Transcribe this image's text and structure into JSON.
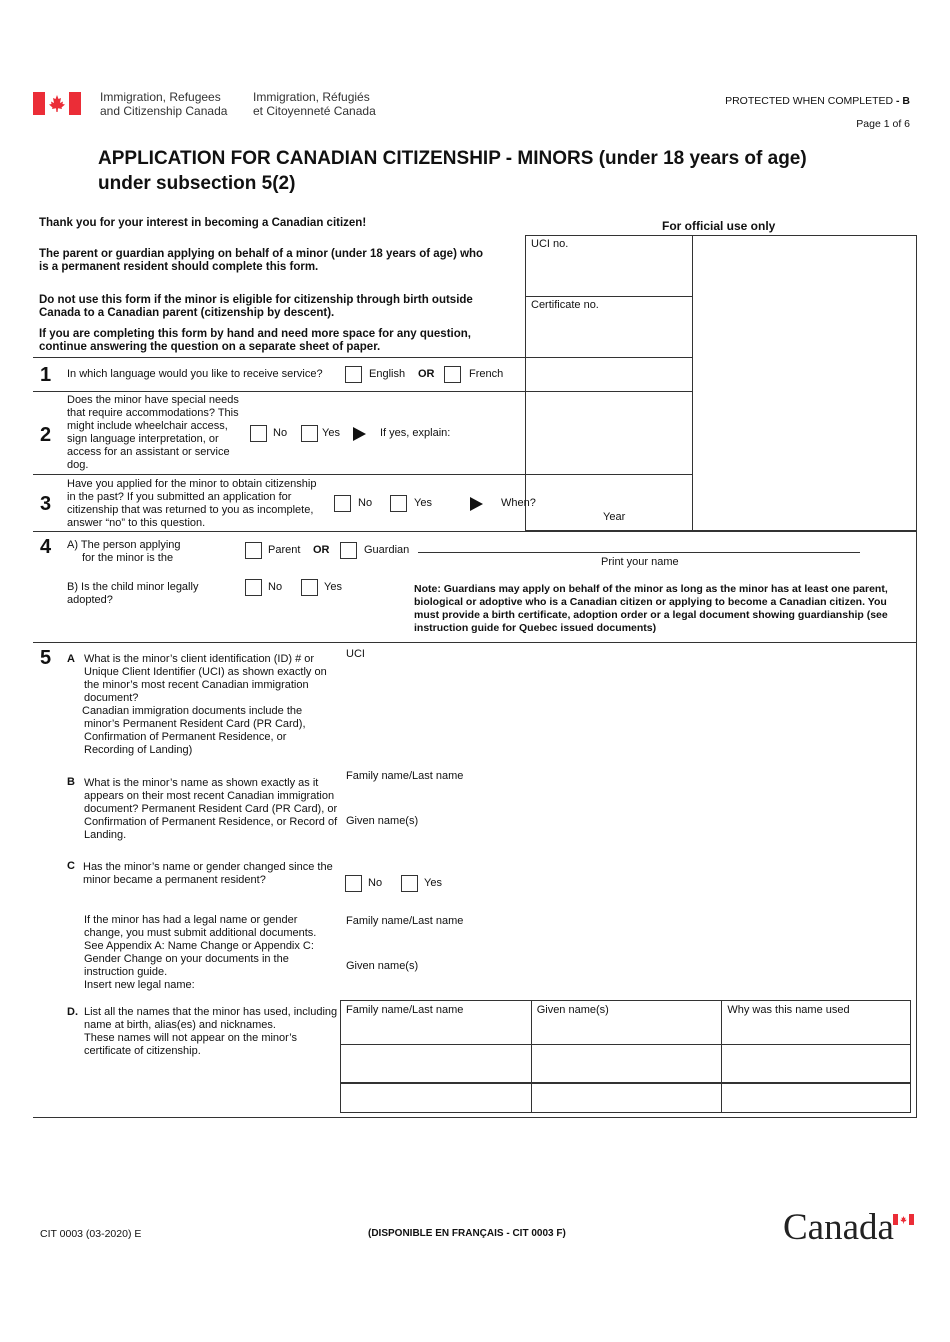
{
  "header": {
    "dept_en_line1": "Immigration, Refugees",
    "dept_en_line2": "and Citizenship Canada",
    "dept_fr_line1": "Immigration, Réfugiés",
    "dept_fr_line2": "et Citoyenneté Canada",
    "protected": "PROTECTED WHEN COMPLETED",
    "protected_level": "- B",
    "page": "Page 1 of 6",
    "flag_color": "#eb2d37"
  },
  "title": {
    "line1": "APPLICATION FOR CANADIAN CITIZENSHIP - MINORS (under 18 years of age)",
    "line2": "under subsection 5(2)"
  },
  "intro": {
    "thanks": "Thank you for your interest in becoming a Canadian citizen!",
    "who_line1": "The parent or guardian applying on behalf of a minor (under 18 years of age) who",
    "who_line2": "is a permanent resident should complete this form.",
    "dont_line1": "Do not use this form if the minor is eligible for citizenship through birth outside",
    "dont_line2": "Canada to a Canadian parent (citizenship by descent).",
    "space_line1": "If you are completing this form by hand and need more space for any question,",
    "space_line2": "continue answering the question on a separate sheet of paper."
  },
  "official": {
    "title": "For official use only",
    "uci_label": "UCI no.",
    "certificate_label": "Certificate no."
  },
  "q1": {
    "num": "1",
    "text": "In which language would you like to receive service?",
    "opt1": "English",
    "or": "OR",
    "opt2": "French"
  },
  "q2": {
    "num": "2",
    "lines": [
      "Does the minor have special needs",
      "that require accommodations? This",
      "might include wheelchair access,",
      "sign language interpretation, or",
      "access for an assistant or service",
      "dog."
    ],
    "no": "No",
    "yes": "Yes",
    "explain": "If yes, explain:"
  },
  "q3": {
    "num": "3",
    "lines": [
      "Have you applied for the minor to obtain citizenship",
      "in the past? If you submitted an application for",
      "citizenship that was returned to you as incomplete,",
      "answer “no” to this question."
    ],
    "no": "No",
    "yes": "Yes",
    "when": "When?",
    "year": "Year"
  },
  "q4": {
    "num": "4",
    "a_line1": "A) The person applying",
    "a_line2": "for the minor is the",
    "parent": "Parent",
    "or": "OR",
    "guardian": "Guardian",
    "print_name": "Print your name",
    "b_line1": "B) Is the child minor legally",
    "b_line2": "adopted?",
    "no": "No",
    "yes": "Yes",
    "note_lines": [
      "Note: Guardians may apply on behalf of the minor as long as the minor has at least one parent,",
      "biological or adoptive who is a Canadian citizen or applying to become a Canadian citizen. You",
      "must provide a birth certificate, adoption order or a legal document showing guardianship (see",
      "instruction guide for Quebec issued documents)"
    ]
  },
  "q5": {
    "num": "5",
    "a_letter": "A",
    "a_lines": [
      "What is the minor’s client identification (ID) # or",
      "Unique Client Identifier (UCI) as shown exactly on",
      "the minor’s most recent Canadian immigration",
      "document?",
      "Canadian immigration documents include the",
      "minor’s Permanent Resident Card (PR Card),",
      "Confirmation of Permanent Residence, or",
      "Recording of Landing)"
    ],
    "a_field": "UCI",
    "b_letter": "B",
    "b_lines": [
      "What is the minor’s name as shown exactly as it",
      "appears on their most recent Canadian immigration",
      "document? Permanent Resident Card (PR Card), or",
      "Confirmation of Permanent Residence, or Record of",
      "Landing."
    ],
    "b_family": "Family name/Last name",
    "b_given": "Given name(s)",
    "c_letter": "C",
    "c_lines": [
      "Has the minor’s name or gender changed since the",
      "minor became a permanent resident?"
    ],
    "c_no": "No",
    "c_yes": "Yes",
    "c2_lines": [
      "If the minor has had a legal name or gender",
      "change, you must submit additional documents.",
      "See Appendix A: Name Change or Appendix C:",
      "Gender Change on your documents in the",
      "instruction guide.",
      "Insert new legal name:"
    ],
    "c_family": "Family name/Last name",
    "c_given": "Given name(s)",
    "d_letter": "D.",
    "d_lines": [
      "List all the names that the minor has used, including",
      "name at birth, alias(es) and nicknames.",
      "These names will not appear on the minor’s",
      "certificate of citizenship."
    ],
    "d_table_headers": [
      "Family name/Last name",
      "Given name(s)",
      "Why was this name used"
    ],
    "d_table_rows": [
      [
        "",
        "",
        ""
      ],
      [
        "",
        "",
        ""
      ]
    ]
  },
  "footer": {
    "form_code": "CIT 0003 (03-2020) E",
    "french": "(DISPONIBLE EN FRANÇAIS - CIT 0003 F)",
    "wordmark": "Canada"
  }
}
